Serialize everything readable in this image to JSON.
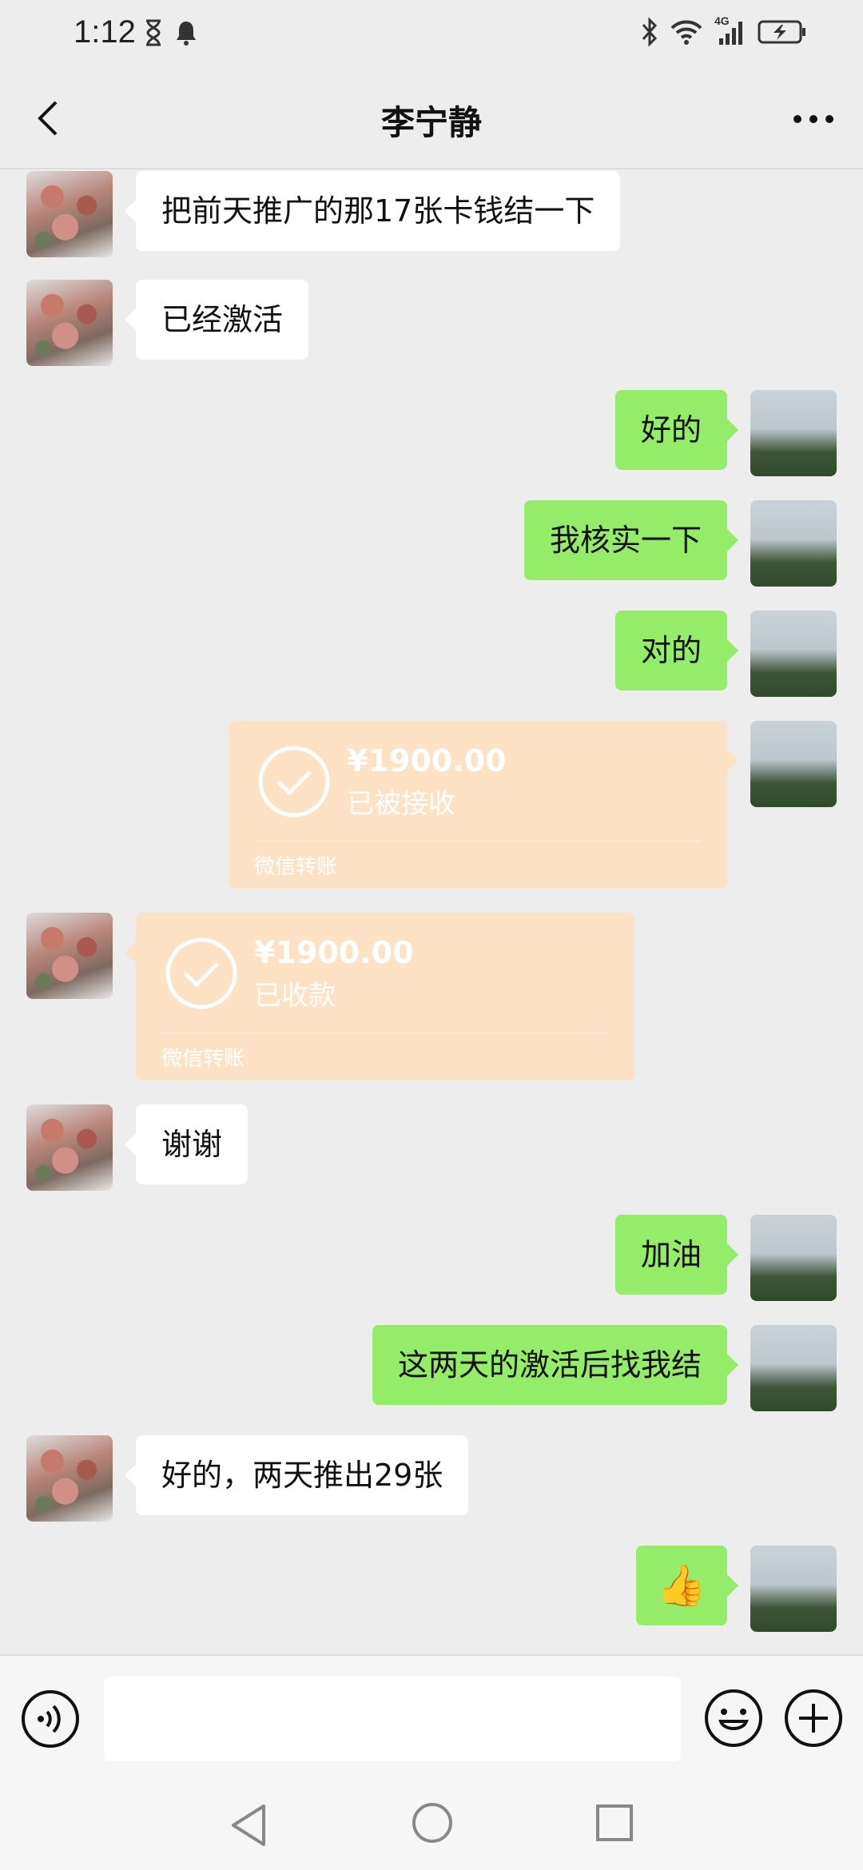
{
  "status_bar": {
    "time": "1:12",
    "network": "4G"
  },
  "header": {
    "title": "李宁静",
    "back_icon": "chevron-left-icon",
    "more_icon": "more-dots-icon"
  },
  "messages": [
    {
      "side": "left",
      "type": "text",
      "text": "把前天推广的那17张卡钱结一下"
    },
    {
      "side": "left",
      "type": "text",
      "text": "已经激活"
    },
    {
      "side": "right",
      "type": "text",
      "text": "好的"
    },
    {
      "side": "right",
      "type": "text",
      "text": "我核实一下"
    },
    {
      "side": "right",
      "type": "text",
      "text": "对的"
    },
    {
      "side": "right",
      "type": "transfer",
      "amount": "¥1900.00",
      "status": "已被接收",
      "footer": "微信转账"
    },
    {
      "side": "left",
      "type": "transfer",
      "amount": "¥1900.00",
      "status": "已收款",
      "footer": "微信转账"
    },
    {
      "side": "left",
      "type": "text",
      "text": "谢谢"
    },
    {
      "side": "right",
      "type": "text",
      "text": "加油"
    },
    {
      "side": "right",
      "type": "text",
      "text": "这两天的激活后找我结"
    },
    {
      "side": "left",
      "type": "text",
      "text": "好的，两天推出29张"
    },
    {
      "side": "right",
      "type": "emoji",
      "text": "👍"
    }
  ],
  "input_bar": {
    "placeholder": "",
    "voice_icon": "voice-icon",
    "emoji_icon": "emoji-icon",
    "plus_icon": "plus-icon"
  },
  "colors": {
    "self_bubble": "#95ec69",
    "other_bubble": "#ffffff",
    "transfer": "#fde2c5",
    "background": "#ededed"
  }
}
